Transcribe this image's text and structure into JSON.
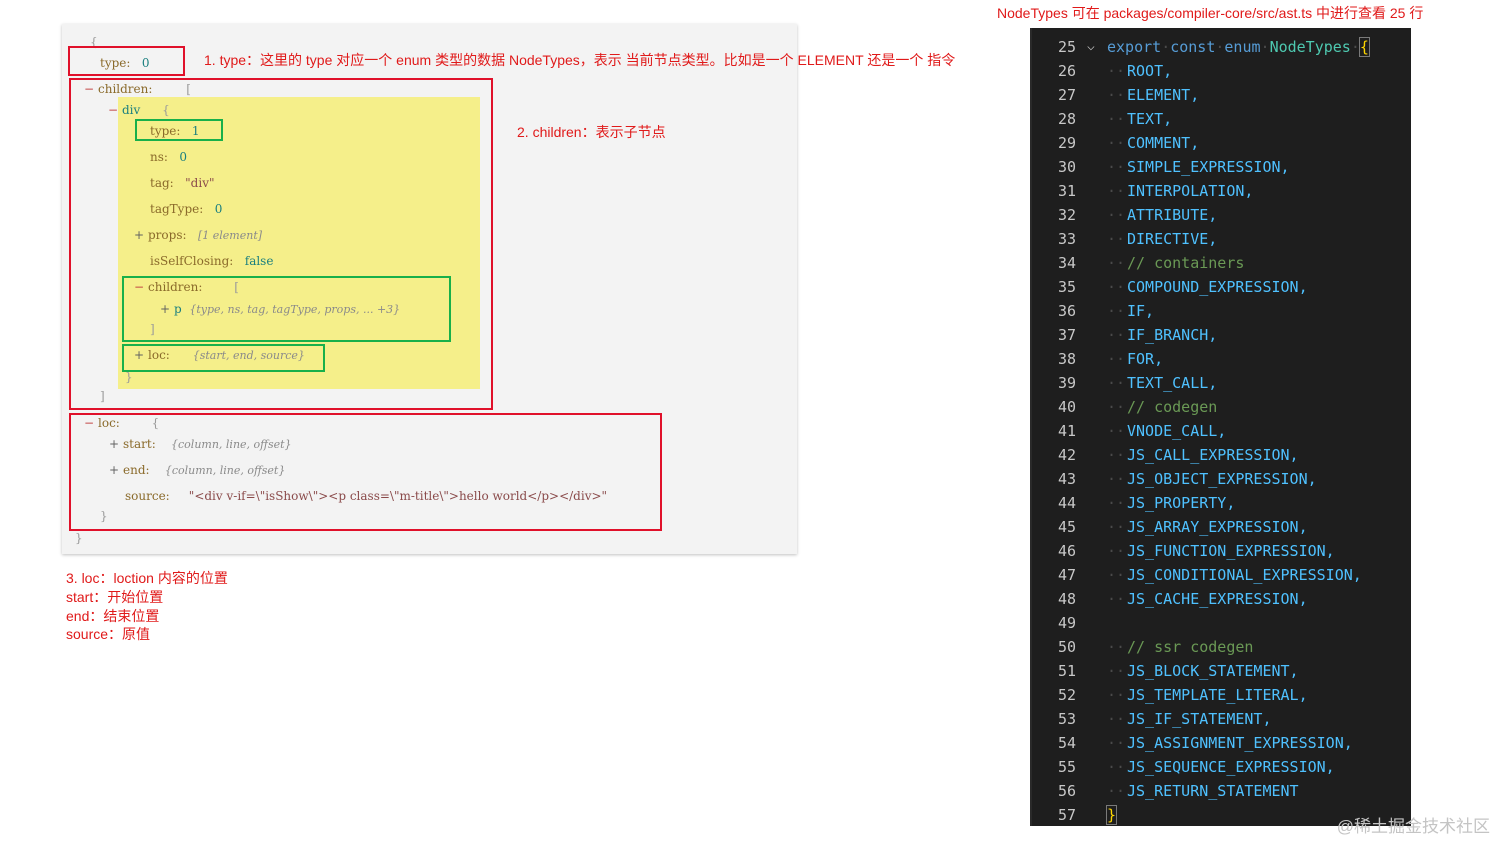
{
  "top_note": "NodeTypes 可在 packages/compiler-core/src/ast.ts 中进行查看 25 行",
  "annotations": {
    "note1": "1. type：这里的 type 对应一个 enum 类型的数据 NodeTypes，表示 当前节点类型。比如是一个 ELEMENT 还是一个 指令",
    "note2": "2. children：表示子节点",
    "note3": [
      "3. loc：loction 内容的位置",
      "start：开始位置",
      "end：结束位置",
      "source：原值"
    ]
  },
  "ast": {
    "root_open": "{",
    "type_key": "type:",
    "type_val": "0",
    "children_key": "children:",
    "children_open": "[",
    "div_key": "div",
    "div_open": "{",
    "div_type_key": "type:",
    "div_type_val": "1",
    "ns_key": "ns:",
    "ns_val": "0",
    "tag_key": "tag:",
    "tag_val": "\"div\"",
    "tagtype_key": "tagType:",
    "tagtype_val": "0",
    "props_key": "props:",
    "props_val": "[1 element]",
    "selfclosing_key": "isSelfClosing:",
    "selfclosing_val": "false",
    "inner_children_key": "children:",
    "inner_children_open": "[",
    "p_key": "p",
    "p_val": "{type, ns, tag, tagType, props, ... +3}",
    "inner_children_close": "]",
    "div_loc_key": "loc:",
    "div_loc_val": "{start, end, source}",
    "div_close": "}",
    "children_close": "]",
    "loc_key": "loc:",
    "loc_open": "{",
    "start_key": "start:",
    "start_val": "{column, line, offset}",
    "end_key": "end:",
    "end_val": "{column, line, offset}",
    "source_key": "source:",
    "source_val": "\"<div v-if=\\\"isShow\\\"><p class=\\\"m-title\\\">hello world</p></div>\"",
    "loc_close": "}",
    "root_close": "}"
  },
  "editor": {
    "header": {
      "num": "25",
      "export": "export",
      "const": "const",
      "enum": "enum",
      "name": "NodeTypes",
      "brace": "{"
    },
    "lines": [
      {
        "num": "26",
        "text": "ROOT,",
        "comment": false
      },
      {
        "num": "27",
        "text": "ELEMENT,",
        "comment": false
      },
      {
        "num": "28",
        "text": "TEXT,",
        "comment": false
      },
      {
        "num": "29",
        "text": "COMMENT,",
        "comment": false
      },
      {
        "num": "30",
        "text": "SIMPLE_EXPRESSION,",
        "comment": false
      },
      {
        "num": "31",
        "text": "INTERPOLATION,",
        "comment": false
      },
      {
        "num": "32",
        "text": "ATTRIBUTE,",
        "comment": false
      },
      {
        "num": "33",
        "text": "DIRECTIVE,",
        "comment": false
      },
      {
        "num": "34",
        "text": "// containers",
        "comment": true
      },
      {
        "num": "35",
        "text": "COMPOUND_EXPRESSION,",
        "comment": false
      },
      {
        "num": "36",
        "text": "IF,",
        "comment": false
      },
      {
        "num": "37",
        "text": "IF_BRANCH,",
        "comment": false
      },
      {
        "num": "38",
        "text": "FOR,",
        "comment": false
      },
      {
        "num": "39",
        "text": "TEXT_CALL,",
        "comment": false
      },
      {
        "num": "40",
        "text": "// codegen",
        "comment": true
      },
      {
        "num": "41",
        "text": "VNODE_CALL,",
        "comment": false
      },
      {
        "num": "42",
        "text": "JS_CALL_EXPRESSION,",
        "comment": false
      },
      {
        "num": "43",
        "text": "JS_OBJECT_EXPRESSION,",
        "comment": false
      },
      {
        "num": "44",
        "text": "JS_PROPERTY,",
        "comment": false
      },
      {
        "num": "45",
        "text": "JS_ARRAY_EXPRESSION,",
        "comment": false
      },
      {
        "num": "46",
        "text": "JS_FUNCTION_EXPRESSION,",
        "comment": false
      },
      {
        "num": "47",
        "text": "JS_CONDITIONAL_EXPRESSION,",
        "comment": false
      },
      {
        "num": "48",
        "text": "JS_CACHE_EXPRESSION,",
        "comment": false
      },
      {
        "num": "49",
        "text": "",
        "comment": false
      },
      {
        "num": "50",
        "text": "// ssr codegen",
        "comment": true
      },
      {
        "num": "51",
        "text": "JS_BLOCK_STATEMENT,",
        "comment": false
      },
      {
        "num": "52",
        "text": "JS_TEMPLATE_LITERAL,",
        "comment": false
      },
      {
        "num": "53",
        "text": "JS_IF_STATEMENT,",
        "comment": false
      },
      {
        "num": "54",
        "text": "JS_ASSIGNMENT_EXPRESSION,",
        "comment": false
      },
      {
        "num": "55",
        "text": "JS_SEQUENCE_EXPRESSION,",
        "comment": false
      },
      {
        "num": "56",
        "text": "JS_RETURN_STATEMENT",
        "comment": false
      }
    ],
    "footer": {
      "num": "57",
      "brace": "}"
    }
  },
  "watermark": "@稀土掘金技术社区"
}
